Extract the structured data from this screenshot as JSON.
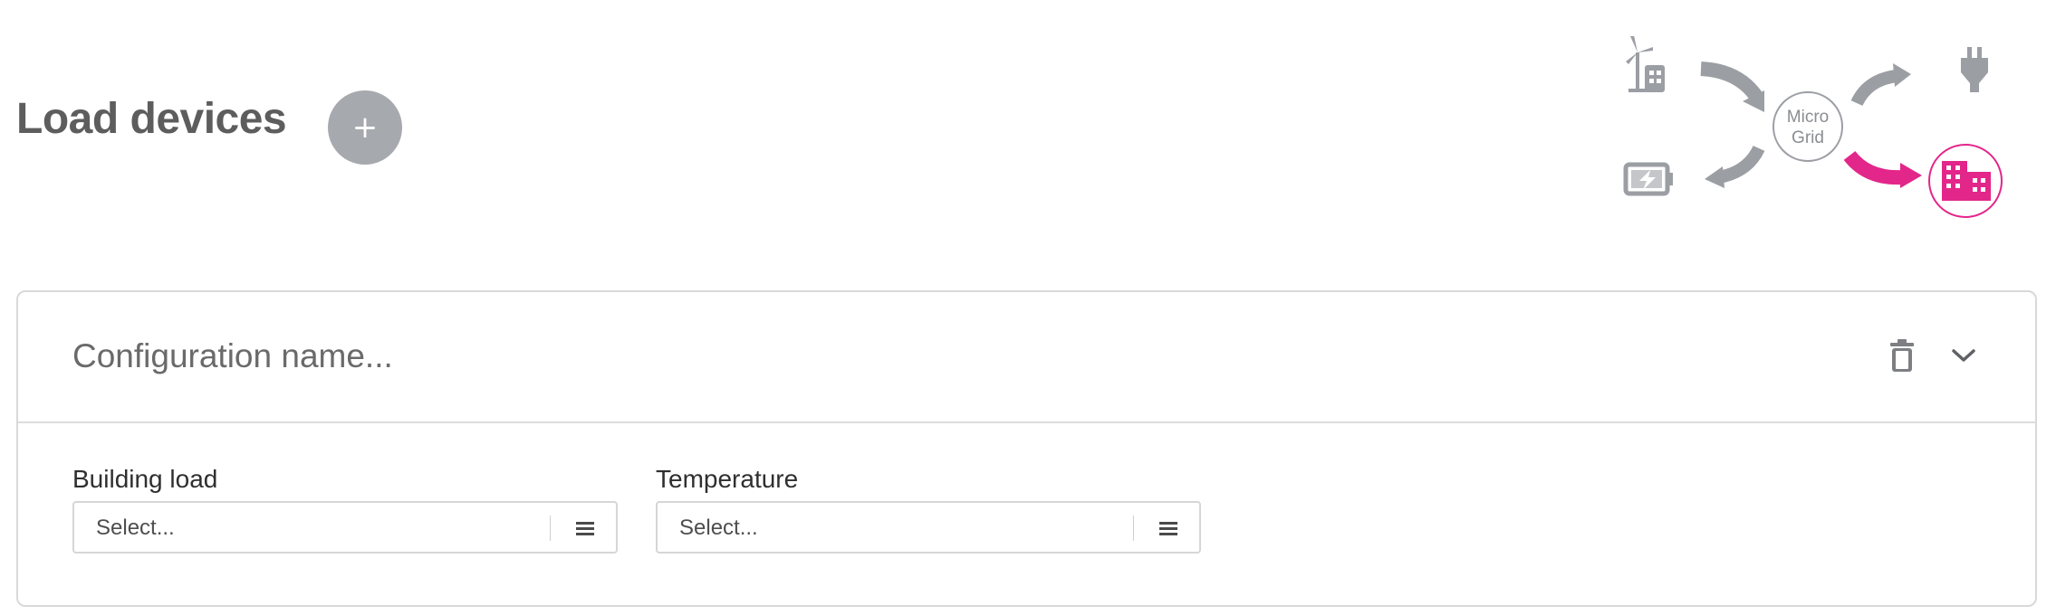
{
  "header": {
    "title": "Load devices",
    "add_label": "+"
  },
  "diagram": {
    "center_label_line1": "Micro",
    "center_label_line2": "Grid",
    "nodes": [
      "wind-solar-icon",
      "battery-icon",
      "grid-plug-icon",
      "building-icon"
    ],
    "active_node": "building-icon",
    "inactive_color": "#9b9ea3",
    "active_color": "#e3268a"
  },
  "card": {
    "name_placeholder": "Configuration name...",
    "fields": [
      {
        "label": "Building load",
        "placeholder": "Select..."
      },
      {
        "label": "Temperature",
        "placeholder": "Select..."
      }
    ]
  }
}
